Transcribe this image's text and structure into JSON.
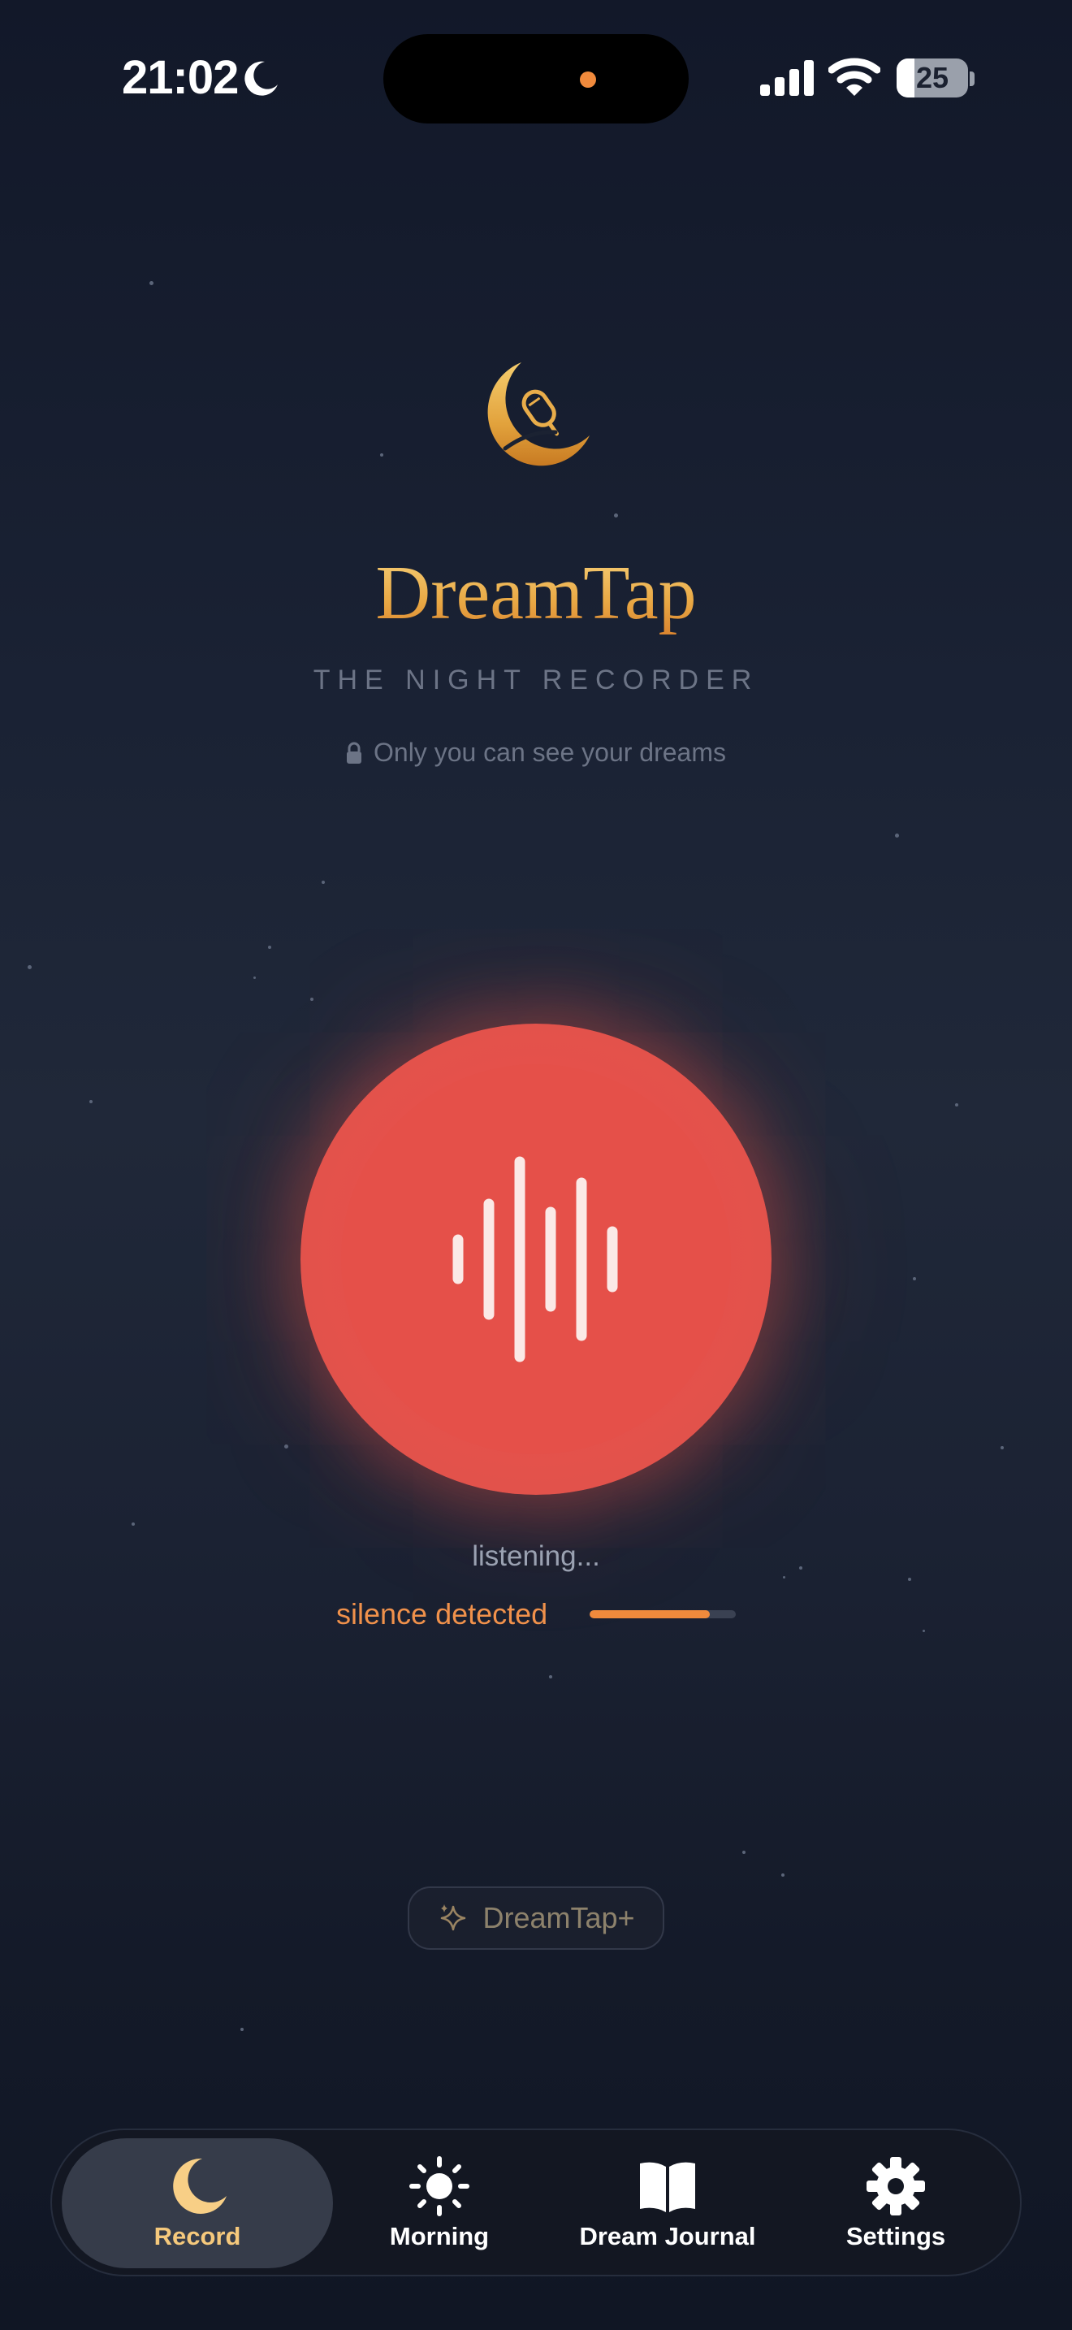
{
  "status_bar": {
    "time": "21:02",
    "battery_level": "25",
    "battery_fraction": 0.25,
    "focus_icon": "moon-icon",
    "signal_icon": "cellular-signal-icon",
    "wifi_icon": "wifi-icon",
    "indicator_color": "#f08a3c"
  },
  "app": {
    "logo_icon": "crescent-moon-microphone-icon",
    "title": "DreamTap",
    "subtitle": "THE NIGHT RECORDER",
    "privacy_note": "Only you can see your dreams",
    "privacy_icon": "lock-icon"
  },
  "recorder": {
    "button_icon": "sound-wave-icon",
    "status": "listening...",
    "silence_label": "silence detected",
    "silence_progress": 0.82,
    "accent_color": "#e6544c"
  },
  "upgrade": {
    "label": "DreamTap+",
    "icon": "sparkle-icon"
  },
  "tabs": [
    {
      "label": "Record",
      "icon": "moon-icon",
      "active": true
    },
    {
      "label": "Morning",
      "icon": "sun-icon",
      "active": false
    },
    {
      "label": "Dream Journal",
      "icon": "book-icon",
      "active": false
    },
    {
      "label": "Settings",
      "icon": "gear-icon",
      "active": false
    }
  ],
  "colors": {
    "background": "#1a2234",
    "gold": "#e9a844",
    "active_tab_label": "#f6c97c",
    "silence": "#f0914b"
  }
}
